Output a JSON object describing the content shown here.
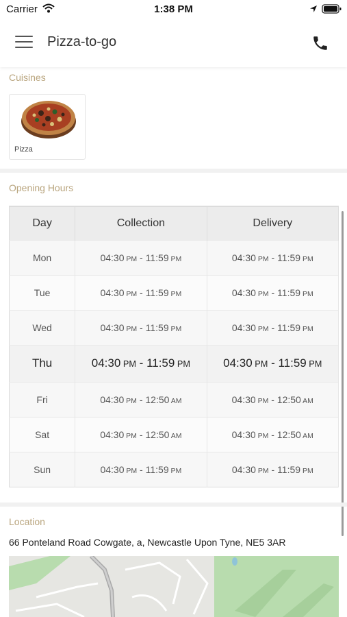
{
  "status_bar": {
    "carrier": "Carrier",
    "time": "1:38 PM"
  },
  "nav": {
    "title": "Pizza-to-go"
  },
  "cuisines": {
    "label": "Cuisines",
    "items": [
      {
        "name": "Pizza"
      }
    ]
  },
  "opening_hours": {
    "label": "Opening Hours",
    "headers": [
      "Day",
      "Collection",
      "Delivery"
    ],
    "rows": [
      {
        "day": "Mon",
        "collection": {
          "open": "04:30",
          "open_period": "PM",
          "close": "11:59",
          "close_period": "PM"
        },
        "delivery": {
          "open": "04:30",
          "open_period": "PM",
          "close": "11:59",
          "close_period": "PM"
        }
      },
      {
        "day": "Tue",
        "collection": {
          "open": "04:30",
          "open_period": "PM",
          "close": "11:59",
          "close_period": "PM"
        },
        "delivery": {
          "open": "04:30",
          "open_period": "PM",
          "close": "11:59",
          "close_period": "PM"
        }
      },
      {
        "day": "Wed",
        "collection": {
          "open": "04:30",
          "open_period": "PM",
          "close": "11:59",
          "close_period": "PM"
        },
        "delivery": {
          "open": "04:30",
          "open_period": "PM",
          "close": "11:59",
          "close_period": "PM"
        }
      },
      {
        "day": "Thu",
        "collection": {
          "open": "04:30",
          "open_period": "PM",
          "close": "11:59",
          "close_period": "PM"
        },
        "delivery": {
          "open": "04:30",
          "open_period": "PM",
          "close": "11:59",
          "close_period": "PM"
        }
      },
      {
        "day": "Fri",
        "collection": {
          "open": "04:30",
          "open_period": "PM",
          "close": "12:50",
          "close_period": "AM"
        },
        "delivery": {
          "open": "04:30",
          "open_period": "PM",
          "close": "12:50",
          "close_period": "AM"
        }
      },
      {
        "day": "Sat",
        "collection": {
          "open": "04:30",
          "open_period": "PM",
          "close": "12:50",
          "close_period": "AM"
        },
        "delivery": {
          "open": "04:30",
          "open_period": "PM",
          "close": "12:50",
          "close_period": "AM"
        }
      },
      {
        "day": "Sun",
        "collection": {
          "open": "04:30",
          "open_period": "PM",
          "close": "11:59",
          "close_period": "PM"
        },
        "delivery": {
          "open": "04:30",
          "open_period": "PM",
          "close": "11:59",
          "close_period": "PM"
        }
      }
    ]
  },
  "location": {
    "label": "Location",
    "address": "66 Ponteland Road Cowgate, a, Newcastle Upon Tyne, NE5 3AR"
  },
  "colors": {
    "section_label": "#b9a57e",
    "map_green": "#b8dcae",
    "map_road": "#a9a9a9"
  },
  "icons": [
    "wifi-icon",
    "location-arrow-icon",
    "battery-icon",
    "menu-icon",
    "phone-icon"
  ]
}
